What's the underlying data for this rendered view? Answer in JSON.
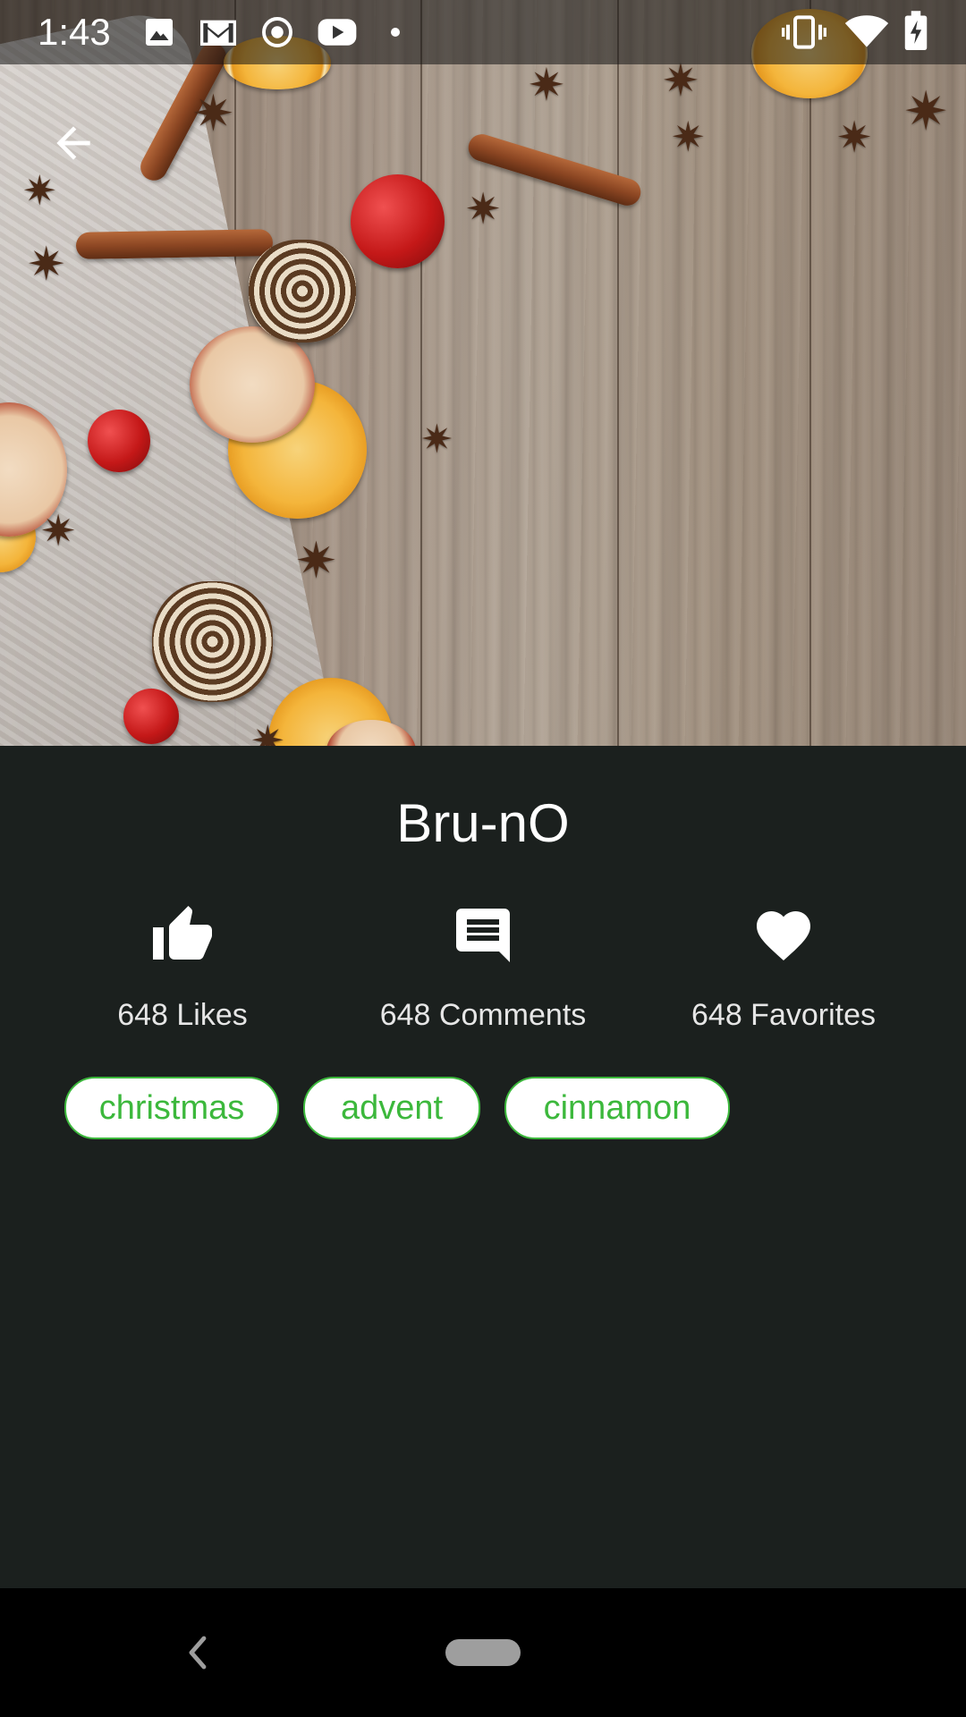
{
  "status_bar": {
    "time": "1:43",
    "icons": [
      "image-icon",
      "gmail-icon",
      "record-icon",
      "youtube-icon",
      "dot-icon",
      "vibrate-icon",
      "wifi-icon",
      "battery-charging-icon"
    ]
  },
  "hero": {
    "icon": "back-arrow-icon"
  },
  "profile": {
    "name": "Bru-nO"
  },
  "stats": [
    {
      "icon": "thumbs-up-icon",
      "label": "648 Likes"
    },
    {
      "icon": "comment-icon",
      "label": "648 Comments"
    },
    {
      "icon": "heart-icon",
      "label": "648 Favorites"
    }
  ],
  "tags": [
    "christmas",
    "advent",
    "cinnamon"
  ],
  "colors": {
    "background": "#1b201e",
    "tag_accent": "#3cb83c",
    "tag_fill": "#ffffff",
    "text": "#ffffff"
  },
  "nav": {
    "icons": [
      "nav-back-icon",
      "nav-home-pill"
    ]
  }
}
